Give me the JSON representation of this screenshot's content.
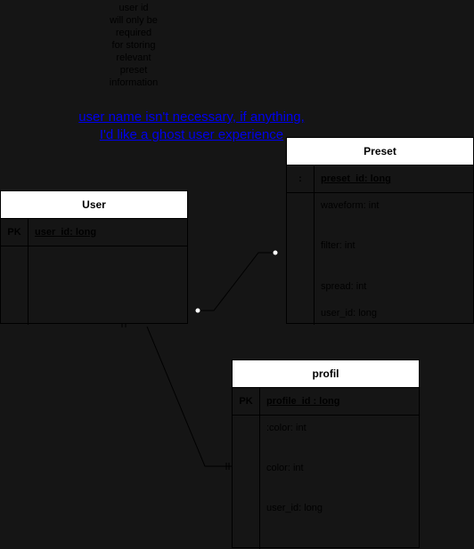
{
  "note": {
    "text": "user id\nwill only be\nrequired\nfor storing\nrelevant\npreset\ninformation"
  },
  "comment": {
    "line1": "user name isn't necessary, if anything, ",
    "line2": "I'd like a ghost user experience"
  },
  "user_table": {
    "title": "User",
    "pk_key": "PK",
    "pk_field": "user_id: long"
  },
  "preset_table": {
    "title": "Preset",
    "pk_key": ":",
    "pk_field": "preset_id: long",
    "attributes": [
      "waveform: int",
      "filter: int",
      "spread: int",
      "user_id: long"
    ]
  },
  "profil_table": {
    "title": "profil",
    "pk_key": "PK",
    "pk_field": "profile_id : long",
    "attributes": [
      ":color: int",
      "color: int",
      "user_id: long"
    ]
  }
}
